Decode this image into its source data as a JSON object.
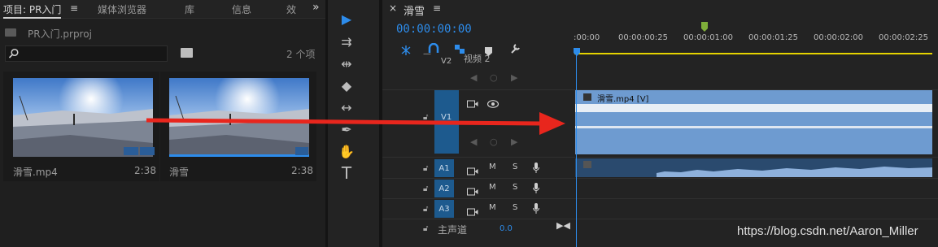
{
  "project_panel": {
    "tabs": [
      {
        "label": "项目: PR入门",
        "active": true
      },
      {
        "label": "媒体浏览器"
      },
      {
        "label": "库"
      },
      {
        "label": "信息"
      },
      {
        "label": "效"
      }
    ],
    "menu_glyph": "≡",
    "overflow_glyph": "»",
    "project_file": "PR入门.prproj",
    "item_count": "2 个项",
    "clips": [
      {
        "name": "滑雪.mp4",
        "duration": "2:38"
      },
      {
        "name": "滑雪",
        "duration": "2:38"
      }
    ]
  },
  "tools": [
    {
      "icon": "selection-tool-icon",
      "glyph": "▶"
    },
    {
      "icon": "track-select-tool-icon",
      "glyph": "⇉"
    },
    {
      "icon": "ripple-edit-tool-icon",
      "glyph": "⇹"
    },
    {
      "icon": "razor-tool-icon",
      "glyph": "◆"
    },
    {
      "icon": "slip-tool-icon",
      "glyph": "↔"
    },
    {
      "icon": "pen-tool-icon",
      "glyph": "✒"
    },
    {
      "icon": "hand-tool-icon",
      "glyph": "✋"
    },
    {
      "icon": "type-tool-icon",
      "glyph": "T"
    }
  ],
  "timeline": {
    "sequence_name": "滑雪",
    "close_glyph": "×",
    "menu_glyph": "≡",
    "timecode": "00:00:00:00",
    "ruler_labels": [
      ":00:00",
      "00:00:00:25",
      "00:00:01:00",
      "00:00:01:25",
      "00:00:02:00",
      "00:00:02:25"
    ],
    "video_tracks": [
      {
        "id": "V2",
        "label": "视频 2"
      },
      {
        "id": "V1",
        "label": "V1"
      }
    ],
    "audio_tracks": [
      {
        "id": "A1",
        "mute": "M",
        "solo": "S"
      },
      {
        "id": "A2",
        "mute": "M",
        "solo": "S"
      },
      {
        "id": "A3",
        "mute": "M",
        "solo": "S"
      }
    ],
    "master": {
      "label": "主声道",
      "value": "0.0"
    },
    "video_clip_label": "滑雪.mp4 [V]"
  },
  "watermark": "https://blog.csdn.net/Aaron_Miller",
  "colors": {
    "accent": "#2d8ceb",
    "track_button": "#1d5a8e",
    "video_clip": "#6e9bd0",
    "arrow": "#e8261d",
    "work_area": "#e5d300"
  }
}
